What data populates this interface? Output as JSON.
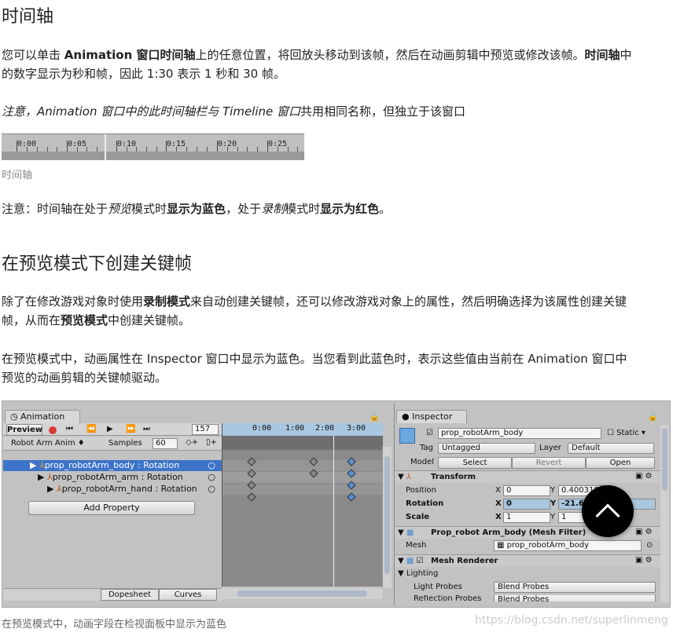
{
  "sections": {
    "timeline_title": "时间轴",
    "preview_title": "在预览模式下创建关键帧"
  },
  "p1": {
    "a": "您可以单击 ",
    "b": "Animation 窗口时间轴",
    "c": "上的任意位置，将回放头移动到该帧，然后在动画剪辑中预览或修改该帧。",
    "d": "时间轴",
    "e": "中",
    "f": "的数字显示为秒和帧，因此 1:30 表示 1 秒和 30 帧。"
  },
  "p2": {
    "a": "注意，Animation 窗口中的此时间轴栏与 Timeline 窗口",
    "b": "共用相同名称，但独立于该窗口"
  },
  "ruler": {
    "labels": [
      "0:00",
      "0:05",
      "0:10",
      "0:15",
      "0:20",
      "0:25"
    ]
  },
  "caption1": "时间轴",
  "p3": {
    "a": "注意：时间轴在处于",
    "b": "预览",
    "c": "模式时",
    "d": "显示为蓝色",
    "e": "，处于",
    "f": "录制",
    "g": "模式时",
    "h": "显示为红色",
    "i": "。"
  },
  "p4": {
    "a": "除了在修改游戏对象时使用",
    "b": "录制模式",
    "c": "来自动创建关键帧，还可以修改游戏对象上的属性，然后明确选择为该属性创建关键",
    "d": "帧，从而在",
    "e": "预览模式",
    "f": "中创建关键帧。"
  },
  "p5": {
    "a": "在预览模式中，动画属性在 Inspector 窗口中显示为蓝色。当您看到此蓝色时，表示这些值由当前在 Animation 窗口中",
    "b": "预览的动画剪辑的关键帧驱动。"
  },
  "anim": {
    "tab": "Animation",
    "preview": "Preview",
    "frame": "157",
    "clip": "Robot Arm Anim",
    "samples_label": "Samples",
    "samples": "60",
    "time_labels": [
      "0:00",
      "1:00",
      "2:00",
      "3:00"
    ],
    "props": [
      {
        "label": "prop_robotArm_body : Rotation",
        "selected": true
      },
      {
        "label": "prop_robotArm_arm : Rotation",
        "selected": false
      },
      {
        "label": "prop_robotArm_hand : Rotation",
        "selected": false
      }
    ],
    "add_property": "Add Property",
    "dopesheet": "Dopesheet",
    "curves": "Curves"
  },
  "inspector": {
    "tab": "Inspector",
    "name": "prop_robotArm_body",
    "static": "Static",
    "tag_label": "Tag",
    "tag": "Untagged",
    "layer_label": "Layer",
    "layer": "Default",
    "model_label": "Model",
    "select": "Select",
    "revert": "Revert",
    "open": "Open",
    "transform": "Transform",
    "position_label": "Position",
    "rotation_label": "Rotation",
    "scale_label": "Scale",
    "pos_x": "0",
    "pos_y": "0.400318",
    "rot_x": "0",
    "rot_y": "-21.6",
    "scale_x": "1",
    "scale_y": "1",
    "mesh_filter": "Prop_robot Arm_body (Mesh Filter)",
    "mesh_label": "Mesh",
    "mesh_value": "prop_robotArm_body",
    "mesh_renderer": "Mesh Renderer",
    "lighting": "Lighting",
    "light_probes_label": "Light Probes",
    "light_probes": "Blend Probes",
    "reflection_label": "Reflection Probes",
    "reflection": "Blend Probes"
  },
  "caption2": "在预览模式中，动画字段在检视面板中显示为蓝色",
  "watermark": "https://blog.csdn.net/superlinmeng",
  "colors": {
    "preview_blue": "#a9c7e0",
    "selected_row": "#3d73c9",
    "record_red": "#d83a3a"
  }
}
